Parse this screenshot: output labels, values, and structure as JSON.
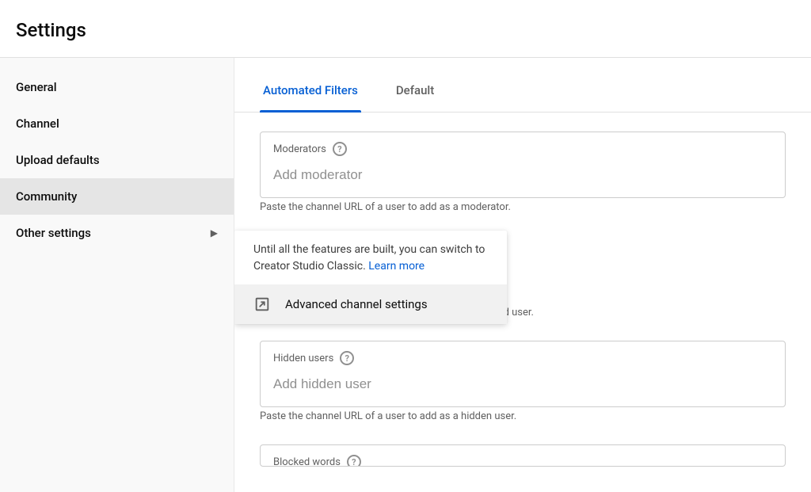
{
  "header": {
    "title": "Settings"
  },
  "sidebar": {
    "items": [
      {
        "label": "General",
        "key": "general"
      },
      {
        "label": "Channel",
        "key": "channel"
      },
      {
        "label": "Upload defaults",
        "key": "upload-defaults"
      },
      {
        "label": "Community",
        "key": "community",
        "selected": true
      },
      {
        "label": "Other settings",
        "key": "other-settings",
        "has_chevron": true
      }
    ]
  },
  "tabs": [
    {
      "label": "Automated Filters",
      "key": "automated-filters",
      "active": true
    },
    {
      "label": "Default",
      "key": "default"
    }
  ],
  "fields": {
    "moderators": {
      "label": "Moderators",
      "placeholder": "Add moderator",
      "hint": "Paste the channel URL of a user to add as a moderator."
    },
    "approved": {
      "hint": "Paste the channel URL of a user to add as an approved user."
    },
    "hidden": {
      "label": "Hidden users",
      "placeholder": "Add hidden user",
      "hint": "Paste the channel URL of a user to add as a hidden user."
    },
    "blocked": {
      "label": "Blocked words"
    }
  },
  "popover": {
    "text_prefix": "Until all the features are built, you can switch to Creator Studio Classic. ",
    "learn_more": "Learn more",
    "action_label": "Advanced channel settings"
  }
}
